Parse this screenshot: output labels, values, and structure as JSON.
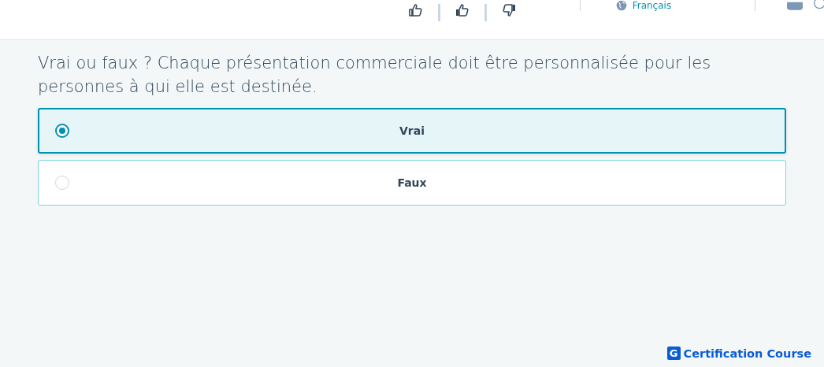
{
  "header": {
    "language": "Français"
  },
  "question": "Vrai ou faux ? Chaque présentation commerciale doit être personnalisée pour les personnes à qui elle est destinée.",
  "options": [
    {
      "label": "Vrai",
      "selected": true
    },
    {
      "label": "Faux",
      "selected": false
    }
  ],
  "brand": {
    "mark": "G",
    "name": "Certification Course"
  }
}
